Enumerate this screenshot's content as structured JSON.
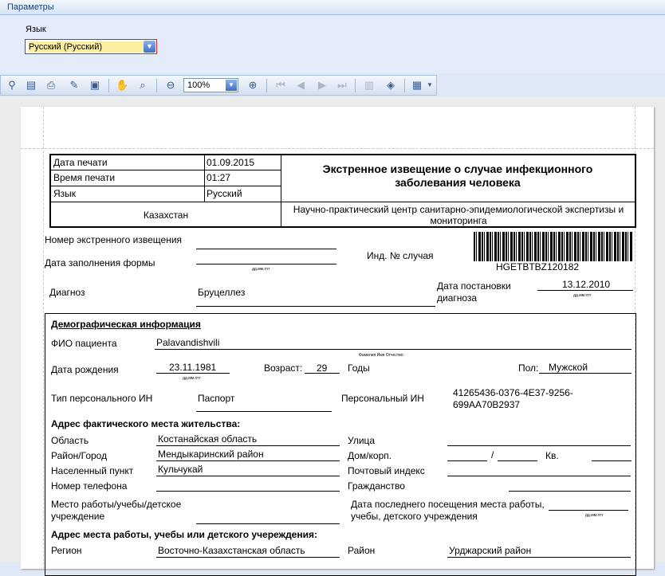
{
  "params": {
    "title": "Параметры",
    "language_label": "Язык",
    "language_value": "Русский (Русский)"
  },
  "toolbar": {
    "zoom": "100%"
  },
  "report": {
    "header": {
      "print_date_label": "Дата печати",
      "print_date": "01.09.2015",
      "print_time_label": "Время печати",
      "print_time": "01:27",
      "language_label": "Язык",
      "language": "Русский",
      "country": "Казахстан",
      "title": "Экстренное извещение о случае инфекционного заболевания человека",
      "center": "Научно-практический центр санитарно-эпидемиологической экспертизы и мониторинга"
    },
    "notice_number_label": "Номер экстренного извещения",
    "fill_date_label": "Дата заполнения формы",
    "date_hint": "дд.мм.гггг",
    "case_id_label": "Инд. № случая",
    "barcode_text": "HGETBTBZ120182",
    "diagnosis_label": "Диагноз",
    "diagnosis": "Бруцеллез",
    "diagnosis_date_label": "Дата постановки диагноза",
    "diagnosis_date": "13.12.2010",
    "demo_title": "Демографическая информация",
    "fio_label": "ФИО пациента",
    "fio": "Palavandishvili",
    "fio_hint": "Фамилия Имя Отчество",
    "dob_label": "Дата рождения",
    "dob": "23.11.1981",
    "age_label": "Возраст:",
    "age": "29",
    "years": "Годы",
    "sex_label": "Пол:",
    "sex": "Мужской",
    "id_type_label": "Тип персонального ИН",
    "id_type": "Паспорт",
    "pid_label": "Персональный ИН",
    "pid": "41265436-0376-4E37-9256-699AA70B2937",
    "address_title": "Адрес фактического места жительства:",
    "region_label": "Область",
    "region": "Костанайская область",
    "street_label": "Улица",
    "district_label": "Район/Город",
    "district": "Мендыкаринский район",
    "house_label": "Дом/корп.",
    "slash": "/",
    "apt_label": "Кв.",
    "settlement_label": "Населенный пункт",
    "settlement": "Кульчукай",
    "zip_label": "Почтовый индекс",
    "phone_label": "Номер телефона",
    "citizenship_label": "Гражданство",
    "work_label": "Место работы/учебы/детское учреждение",
    "last_visit_label": "Дата последнего посещения места работы, учебы, детского учреждения",
    "work_address_title": "Адрес места работы, учебы или детского учереждения:",
    "work_region_label": "Регион",
    "work_region": "Восточно-Казахстанская область",
    "work_district_label": "Район",
    "work_district": "Урджарский район"
  }
}
